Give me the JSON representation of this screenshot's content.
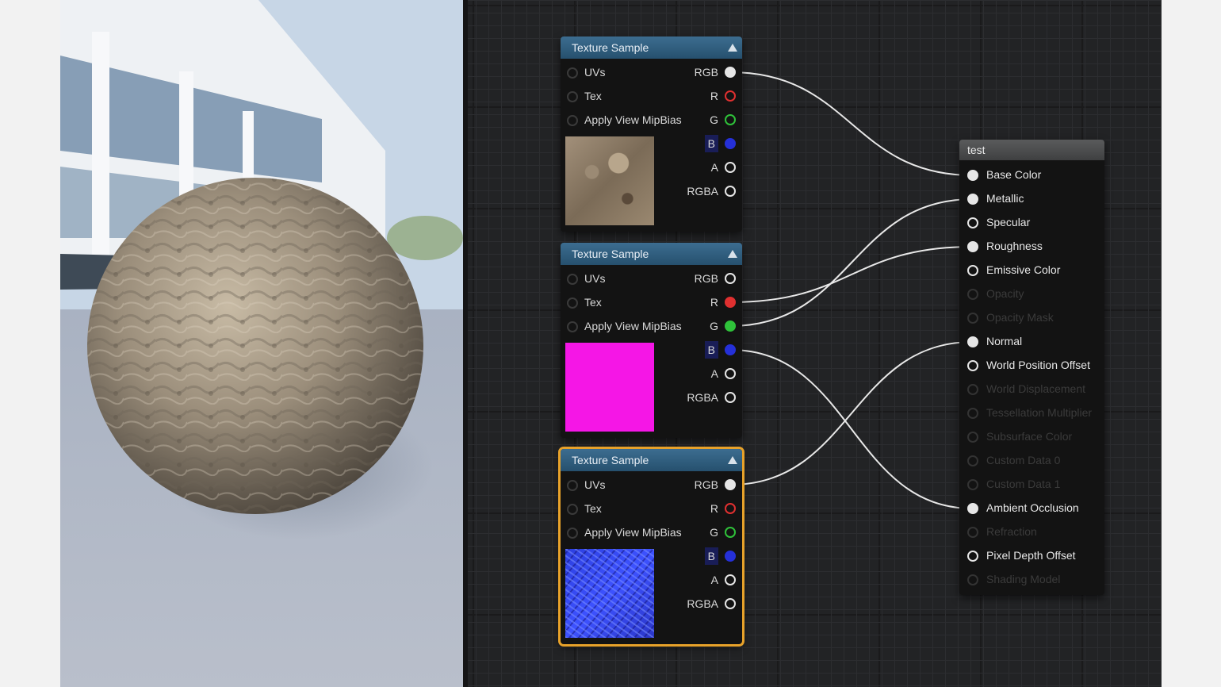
{
  "texture_nodes": [
    {
      "title": "Texture Sample",
      "inputs": [
        "UVs",
        "Tex",
        "Apply View MipBias"
      ],
      "outputs": [
        "RGB",
        "R",
        "G",
        "B",
        "A",
        "RGBA"
      ],
      "preview": "dirt-albedo"
    },
    {
      "title": "Texture Sample",
      "inputs": [
        "UVs",
        "Tex",
        "Apply View MipBias"
      ],
      "outputs": [
        "RGB",
        "R",
        "G",
        "B",
        "A",
        "RGBA"
      ],
      "preview": "magenta-mask"
    },
    {
      "title": "Texture Sample",
      "inputs": [
        "UVs",
        "Tex",
        "Apply View MipBias"
      ],
      "outputs": [
        "RGB",
        "R",
        "G",
        "B",
        "A",
        "RGBA"
      ],
      "preview": "normal-map"
    }
  ],
  "material_node": {
    "title": "test",
    "inputs": [
      {
        "label": "Base Color",
        "enabled": true,
        "connected": true
      },
      {
        "label": "Metallic",
        "enabled": true,
        "connected": true
      },
      {
        "label": "Specular",
        "enabled": true,
        "connected": false
      },
      {
        "label": "Roughness",
        "enabled": true,
        "connected": true
      },
      {
        "label": "Emissive Color",
        "enabled": true,
        "connected": false
      },
      {
        "label": "Opacity",
        "enabled": false,
        "connected": false
      },
      {
        "label": "Opacity Mask",
        "enabled": false,
        "connected": false
      },
      {
        "label": "Normal",
        "enabled": true,
        "connected": true
      },
      {
        "label": "World Position Offset",
        "enabled": true,
        "connected": false
      },
      {
        "label": "World Displacement",
        "enabled": false,
        "connected": false
      },
      {
        "label": "Tessellation Multiplier",
        "enabled": false,
        "connected": false
      },
      {
        "label": "Subsurface Color",
        "enabled": false,
        "connected": false
      },
      {
        "label": "Custom Data 0",
        "enabled": false,
        "connected": false
      },
      {
        "label": "Custom Data 1",
        "enabled": false,
        "connected": false
      },
      {
        "label": "Ambient Occlusion",
        "enabled": true,
        "connected": true
      },
      {
        "label": "Refraction",
        "enabled": false,
        "connected": false
      },
      {
        "label": "Pixel Depth Offset",
        "enabled": true,
        "connected": false
      },
      {
        "label": "Shading Model",
        "enabled": false,
        "connected": false
      }
    ]
  },
  "pin_colors": {
    "RGB": "#e6e6e6",
    "R": "#e03030",
    "G": "#2fc23a",
    "B": "#2530d8",
    "A": "#e6e6e6",
    "RGBA": "#e6e6e6"
  },
  "connections": [
    {
      "from_node": 0,
      "from_pin": "RGB",
      "to": "Base Color"
    },
    {
      "from_node": 1,
      "from_pin": "R",
      "to": "Roughness"
    },
    {
      "from_node": 1,
      "from_pin": "G",
      "to": "Metallic"
    },
    {
      "from_node": 1,
      "from_pin": "B",
      "to": "Ambient Occlusion"
    },
    {
      "from_node": 2,
      "from_pin": "RGB",
      "to": "Normal"
    }
  ],
  "colors": {
    "selection": "#e8a22a",
    "node_header": "#2f5f80",
    "graph_bg": "#222325"
  }
}
